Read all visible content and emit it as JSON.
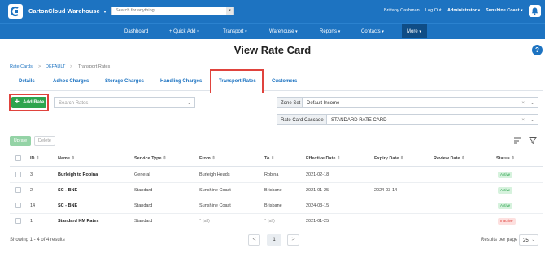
{
  "colors": {
    "primary": "#1d73c1",
    "nav_more": "#0f4d86",
    "highlight": "#e0433d",
    "add_button": "#2da44e",
    "active_badge": "#2da44e",
    "inactive_badge": "#e0433d"
  },
  "topbar": {
    "brand": "CartonCloud Warehouse",
    "search_placeholder": "Search for anything!",
    "user": "Brittany Cashman",
    "logout": "Log Out",
    "role": "Administrator",
    "region": "Sunshine Coast",
    "icons": [
      "cartoncloud-logo-icon",
      "chevron-down-icon",
      "bell-icon"
    ]
  },
  "nav": {
    "dashboard": "Dashboard",
    "quick_add": "+ Quick Add",
    "transport": "Transport",
    "warehouse": "Warehouse",
    "reports": "Reports",
    "contacts": "Contacts",
    "more": "More"
  },
  "page": {
    "title": "View Rate Card",
    "help": "?"
  },
  "breadcrumb": {
    "rate_cards": "Rate Cards",
    "default": "DEFAULT",
    "transport_rates": "Transport Rates",
    "separator": ">"
  },
  "tabs": {
    "details": "Details",
    "adhoc": "Adhoc Charges",
    "storage": "Storage Charges",
    "handling": "Handling Charges",
    "transport": "Transport Rates",
    "customers": "Customers",
    "active": "Transport Rates"
  },
  "toolbar": {
    "add_rate": "Add Rate",
    "search_placeholder": "Search Rates",
    "zone_set_label": "Zone Set",
    "zone_set_value": "Default Income",
    "cascade_label": "Rate Card Cascade",
    "cascade_value": "STANDARD RATE CARD",
    "upgrade": "Uprate",
    "delete": "Delete"
  },
  "table": {
    "headers": {
      "id": "ID",
      "name": "Name",
      "service_type": "Service Type",
      "from": "From",
      "to": "To",
      "effective": "Effective Date",
      "expiry": "Expiry Date",
      "review": "Review Date",
      "status": "Status"
    },
    "rows": [
      {
        "id": "3",
        "name": "Burleigh to Robina",
        "service_type": "General",
        "from": "Burleigh Heads",
        "to": "Robina",
        "effective": "2021-02-18",
        "expiry": "",
        "review": "",
        "status": "Active"
      },
      {
        "id": "2",
        "name": "SC - BNE",
        "service_type": "Standard",
        "from": "Sunshine Coast",
        "to": "Brisbane",
        "effective": "2021-01-25",
        "expiry": "2024-03-14",
        "review": "",
        "status": "Active"
      },
      {
        "id": "14",
        "name": "SC - BNE",
        "service_type": "Standard",
        "from": "Sunshine Coast",
        "to": "Brisbane",
        "effective": "2024-03-15",
        "expiry": "",
        "review": "",
        "status": "Active"
      },
      {
        "id": "1",
        "name": "Standard KM Rates",
        "service_type": "Standard",
        "from": "* (all)",
        "to": "* (all)",
        "effective": "2021-01-25",
        "expiry": "",
        "review": "",
        "status": "Inactive"
      }
    ]
  },
  "footer": {
    "showing": "Showing 1 - 4 of 4 results",
    "page": "1",
    "prev": "<",
    "next": ">",
    "per_page_label": "Results per page",
    "per_page_value": "25"
  }
}
